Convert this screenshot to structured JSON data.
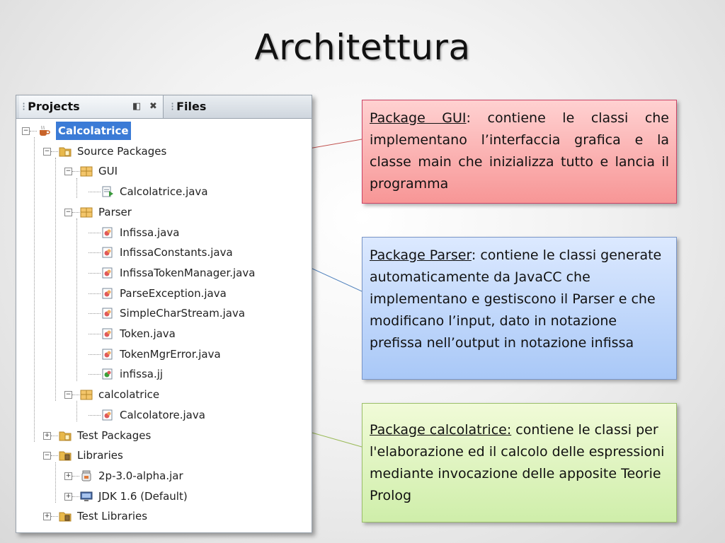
{
  "title": "Architettura",
  "panel": {
    "tabs": {
      "projects": "Projects",
      "files": "Files"
    },
    "tree": [
      {
        "label": "Calcolatrice",
        "icon": "coffee-cup-icon",
        "expander": "−",
        "selected": true
      },
      {
        "label": "Source Packages",
        "icon": "folder-icon",
        "expander": "−"
      },
      {
        "label": "GUI",
        "icon": "package-icon",
        "expander": "−"
      },
      {
        "label": "Calcolatrice.java",
        "icon": "main-java-file-icon",
        "expander": ""
      },
      {
        "label": "Parser",
        "icon": "package-icon",
        "expander": "−"
      },
      {
        "label": "Infissa.java",
        "icon": "java-file-icon",
        "expander": ""
      },
      {
        "label": "InfissaConstants.java",
        "icon": "java-file-icon",
        "expander": ""
      },
      {
        "label": "InfissaTokenManager.java",
        "icon": "java-file-icon",
        "expander": ""
      },
      {
        "label": "ParseException.java",
        "icon": "java-file-icon",
        "expander": ""
      },
      {
        "label": "SimpleCharStream.java",
        "icon": "java-file-icon",
        "expander": ""
      },
      {
        "label": "Token.java",
        "icon": "java-file-icon",
        "expander": ""
      },
      {
        "label": "TokenMgrError.java",
        "icon": "java-file-icon",
        "expander": ""
      },
      {
        "label": "infissa.jj",
        "icon": "jj-file-icon",
        "expander": ""
      },
      {
        "label": "calcolatrice",
        "icon": "package-icon",
        "expander": "−"
      },
      {
        "label": "Calcolatore.java",
        "icon": "java-file-icon",
        "expander": ""
      },
      {
        "label": "Test Packages",
        "icon": "folder-icon",
        "expander": "+"
      },
      {
        "label": "Libraries",
        "icon": "library-folder-icon",
        "expander": "−"
      },
      {
        "label": "2p-3.0-alpha.jar",
        "icon": "jar-icon",
        "expander": "+"
      },
      {
        "label": "JDK 1.6 (Default)",
        "icon": "jdk-icon",
        "expander": "+"
      },
      {
        "label": "Test Libraries",
        "icon": "library-folder-icon",
        "expander": "+"
      }
    ]
  },
  "callouts": {
    "gui": {
      "title": "Package GUI",
      "text": ": contiene le classi che implementano l’interfaccia grafica e la classe main che inizializza tutto e lancia il programma"
    },
    "parser": {
      "title": "Package Parser",
      "text": ": contiene le classi generate automaticamente da JavaCC che implementano e gestiscono il Parser e che modificano l’input, dato in notazione prefissa nell’output in notazione infissa"
    },
    "calcolatrice": {
      "title": "Package calcolatrice:",
      "text": " contiene le classi per l'elaborazione ed il calcolo delle espressioni mediante invocazione delle apposite Teorie Prolog"
    }
  },
  "colors": {
    "gui_line": "#c0504d",
    "parser_line": "#4f81bd",
    "calc_line": "#9bbb59",
    "selection": "#3b7bd6"
  }
}
